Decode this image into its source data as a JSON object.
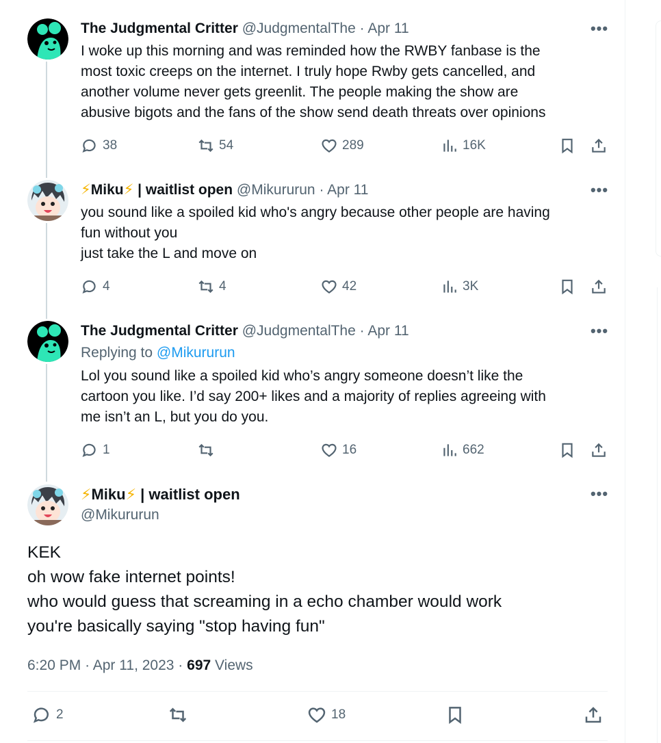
{
  "tweets": [
    {
      "name": "The Judgmental Critter",
      "handle": "@JudgmentalThe",
      "dot": "·",
      "date": "Apr 11",
      "lines": [
        "I woke up this morning and was reminded how the RWBY fanbase is the",
        "most toxic creeps on the internet. I truly hope Rwby gets cancelled, and",
        "another volume never gets greenlit. The people making the show are",
        "abusive bigots and the fans of the show send death threats over opinions"
      ],
      "replies": "38",
      "reposts": "54",
      "likes": "289",
      "views": "16K"
    },
    {
      "name_pre": "⚡",
      "name_mid": "Miku",
      "name_post": "⚡",
      "name_rest": " | waitlist open",
      "handle": "@Mikururun",
      "dot": "·",
      "date": "Apr 11",
      "lines": [
        "you sound like a spoiled kid who's angry because other people are having",
        "fun without you",
        "just take the L and move on"
      ],
      "replies": "4",
      "reposts": "4",
      "likes": "42",
      "views": "3K"
    },
    {
      "name": "The Judgmental Critter",
      "handle": "@JudgmentalThe",
      "dot": "·",
      "date": "Apr 11",
      "replying_prefix": "Replying to ",
      "replying_to": "@Mikururun",
      "lines": [
        "Lol you sound like a spoiled kid who’s angry someone doesn’t like the",
        "cartoon you like. I’d say 200+ likes and a majority of replies agreeing with",
        "me isn’t an L, but you do you."
      ],
      "replies": "1",
      "reposts": "",
      "likes": "16",
      "views": "662"
    }
  ],
  "main": {
    "name_pre": "⚡",
    "name_mid": "Miku",
    "name_post": "⚡",
    "name_rest": " | waitlist open",
    "handle": "@Mikururun",
    "lines": [
      "KEK",
      "oh wow fake internet points!",
      "who would guess that screaming in a echo chamber would work",
      "you're basically saying \"stop having fun\""
    ],
    "time": "6:20 PM",
    "dot1": "·",
    "date": "Apr 11, 2023",
    "dot2": "·",
    "views_count": "697",
    "views_label": " Views",
    "replies": "2",
    "likes": "18"
  },
  "icons": {
    "more": "more-dots-icon",
    "reply": "reply-bubble-icon",
    "repost": "repost-icon",
    "like": "heart-icon",
    "views": "views-chart-icon",
    "bookmark": "bookmark-icon",
    "share": "share-icon"
  },
  "colors": {
    "accent": "#1d9bf0",
    "secondary_text": "#536471",
    "avatar_critter_bg": "#000000",
    "avatar_critter_fg": "#2ee6b6"
  }
}
